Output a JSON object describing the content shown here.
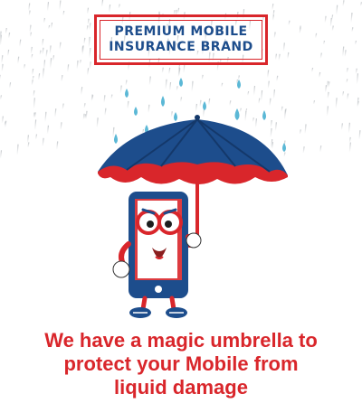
{
  "brand_stamp": {
    "line1": "PREMIUM MOBILE",
    "line2": "INSURANCE BRAND"
  },
  "tagline": {
    "line1": "We have a magic umbrella to",
    "line2": "protect your Mobile from",
    "line3": "liquid damage"
  },
  "colors": {
    "brand_red": "#d9262b",
    "brand_blue": "#1d4d8c",
    "drop_blue": "#5bb8d6"
  },
  "icons": [
    "rain-drop-icon",
    "umbrella-icon",
    "phone-mascot-icon"
  ]
}
